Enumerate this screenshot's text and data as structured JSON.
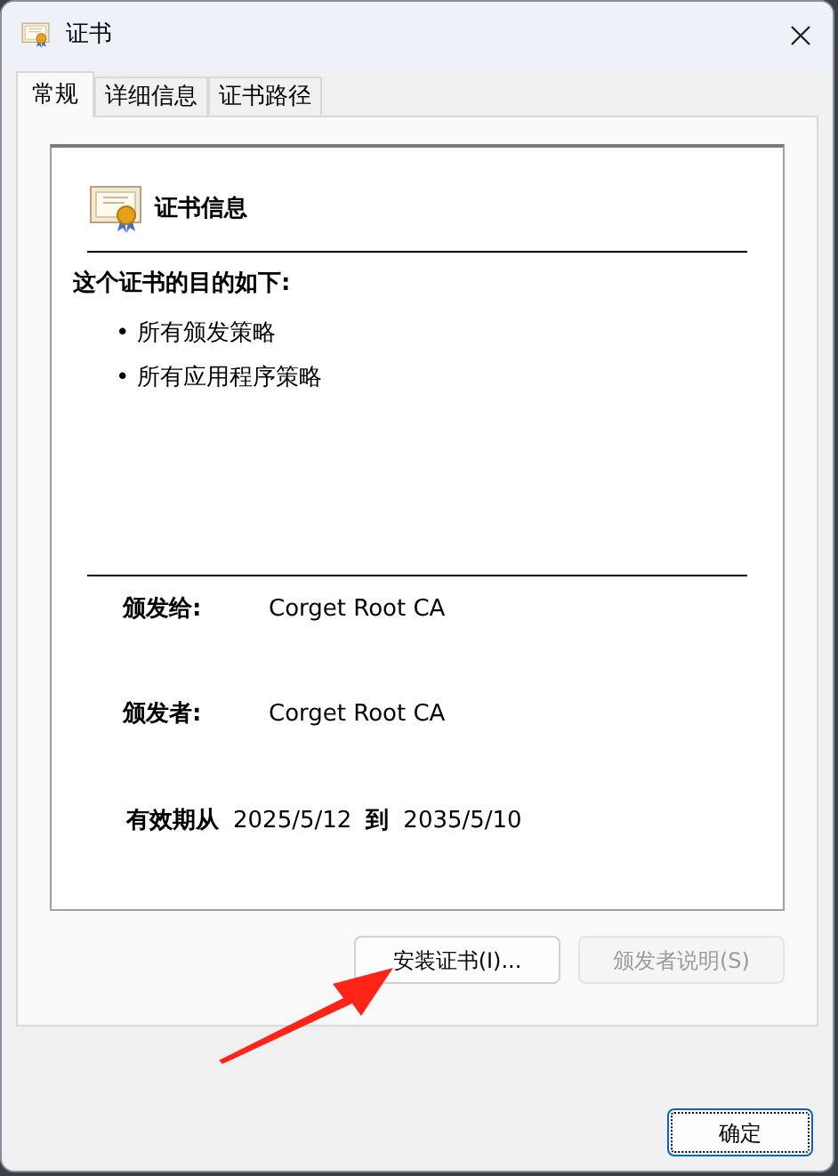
{
  "window": {
    "title": "证书"
  },
  "tabs": [
    {
      "label": "常规",
      "selected": true
    },
    {
      "label": "详细信息",
      "selected": false
    },
    {
      "label": "证书路径",
      "selected": false
    }
  ],
  "info": {
    "heading": "证书信息",
    "purpose_title": "这个证书的目的如下:",
    "purposes": [
      "• 所有颁发策略",
      "• 所有应用程序策略"
    ]
  },
  "fields": [
    {
      "label": "颁发给:",
      "value": "Corget Root CA"
    },
    {
      "label": "颁发者:",
      "value": "Corget Root CA"
    }
  ],
  "validity": {
    "label": "有效期从",
    "from": "2025/5/12",
    "to_label": "到",
    "to": "2035/5/10"
  },
  "buttons": [
    {
      "label": "安装证书(I)...",
      "disabled": false
    },
    {
      "label": "颁发者说明(S)",
      "disabled": true
    }
  ],
  "ok_button": {
    "label": "确定",
    "focused": true
  },
  "annotations": [
    {
      "kind": "arrow"
    }
  ]
}
